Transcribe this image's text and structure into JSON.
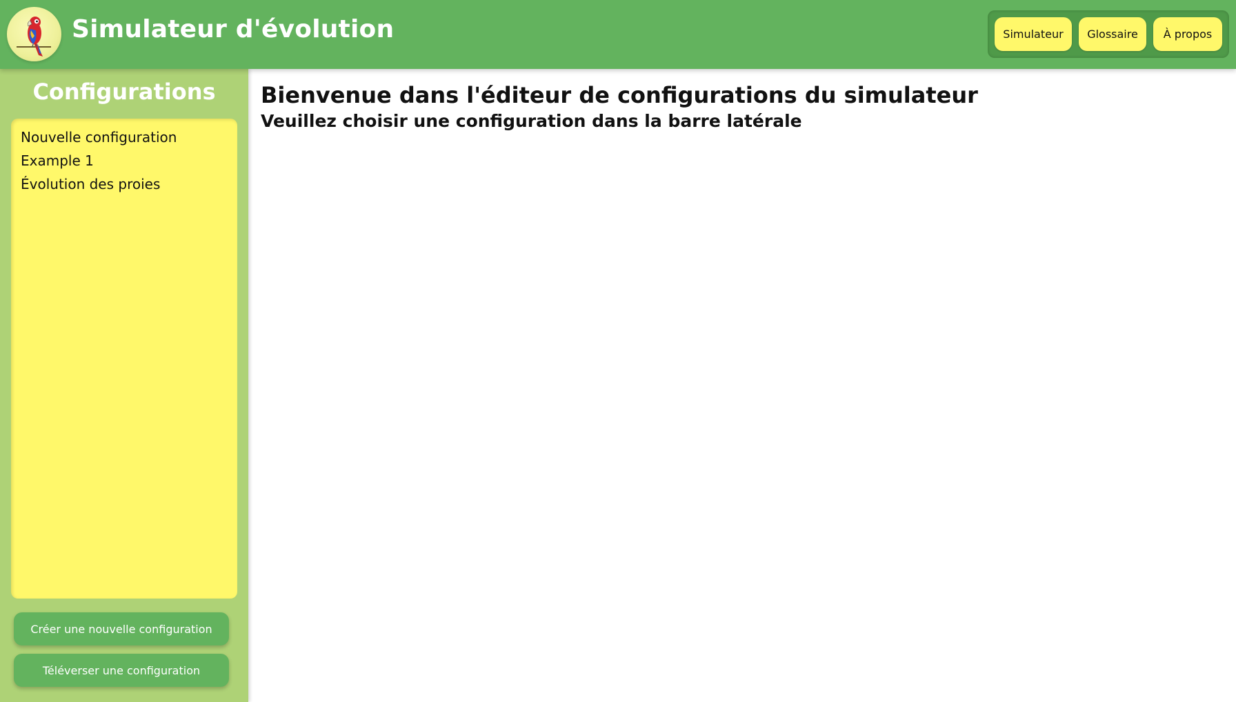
{
  "header": {
    "title": "Simulateur d'évolution",
    "logo_icon": "parrot-icon",
    "nav": [
      {
        "label": "Simulateur"
      },
      {
        "label": "Glossaire"
      },
      {
        "label": "À propos"
      }
    ]
  },
  "sidebar": {
    "title": "Configurations",
    "items": [
      {
        "label": "Nouvelle configuration"
      },
      {
        "label": "Example 1"
      },
      {
        "label": "Évolution des proies"
      }
    ],
    "create_button": "Créer une nouvelle configuration",
    "upload_button": "Téléverser une configuration"
  },
  "main": {
    "title": "Bienvenue dans l'éditeur de configurations du simulateur",
    "subtitle": "Veuillez choisir une configuration dans la barre latérale"
  },
  "colors": {
    "header_green": "#63b35e",
    "sidebar_green": "#aed276",
    "nav_yellow": "#fff86a",
    "list_yellow": "#fff86a"
  }
}
